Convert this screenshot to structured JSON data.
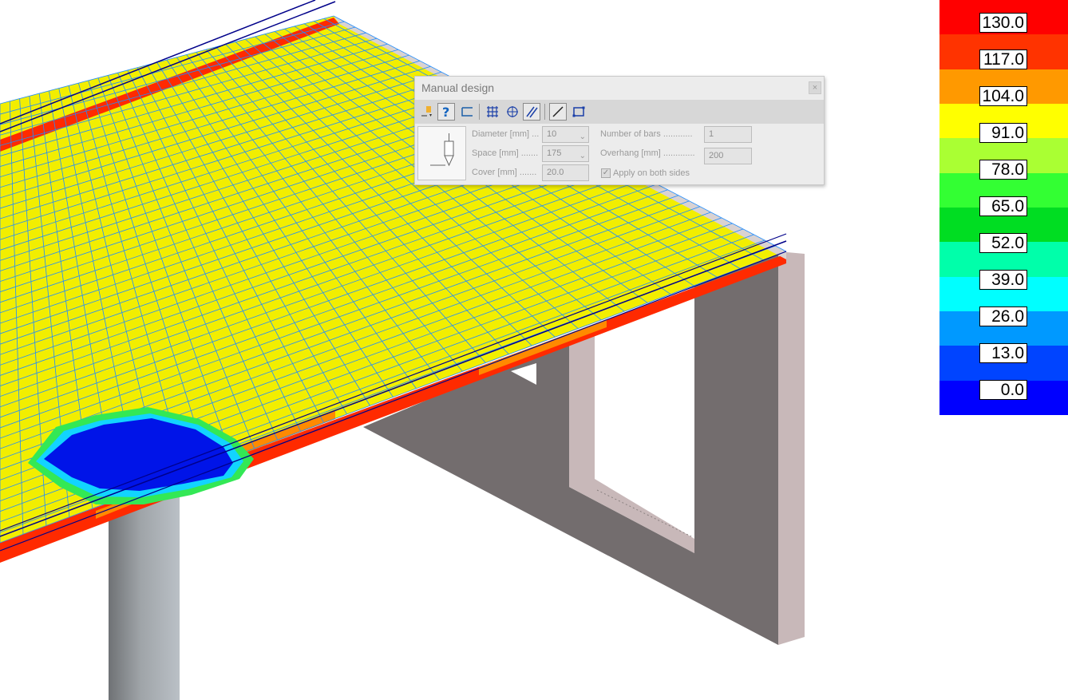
{
  "legend": {
    "ticks": [
      "130.0",
      "117.0",
      "104.0",
      "91.0",
      "78.0",
      "65.0",
      "52.0",
      "39.0",
      "26.0",
      "13.0",
      "0.0"
    ],
    "band_colors": [
      "#ff0000",
      "#ff3300",
      "#ff9900",
      "#ffff00",
      "#aaff33",
      "#33ff33",
      "#00dd22",
      "#00ffaa",
      "#00ffff",
      "#0099ff",
      "#0044ff",
      "#0000ff"
    ]
  },
  "colors": {
    "slab_yellow": "#f2ee00",
    "slab_red": "#ff2a00",
    "slab_orange": "#ff8a00",
    "hole_blue": "#0014e8",
    "hole_ring_cyan": "#12d4ff",
    "hole_ring_green": "#33e855",
    "grid_line": "#1f8cff",
    "edge_line": "#00008a",
    "wall_face": "#736d6e",
    "wall_edge": "#c8b8b9",
    "column_dark": "#6f7275",
    "column_light": "#bac0c6"
  },
  "dialog": {
    "title": "Manual design",
    "close": "×",
    "toolbar": [
      "pointer-tool-icon",
      "help-icon",
      "bar-shape-icon",
      "mesh-grid-icon",
      "circular-mesh-icon",
      "parallel-bars-icon",
      "line-tool-icon",
      "rectangle-tool-icon"
    ],
    "diameter": {
      "label": "Diameter [mm] ...",
      "value": "10"
    },
    "space": {
      "label": "Space [mm] .......",
      "value": "175"
    },
    "cover": {
      "label": "Cover [mm] .......",
      "value": "20.0"
    },
    "number_of_bars": {
      "label": "Number of bars ............",
      "value": "1"
    },
    "overhang": {
      "label": "Overhang [mm] .............",
      "value": "200"
    },
    "apply_both": {
      "label": "Apply on both sides",
      "checked": true
    }
  }
}
